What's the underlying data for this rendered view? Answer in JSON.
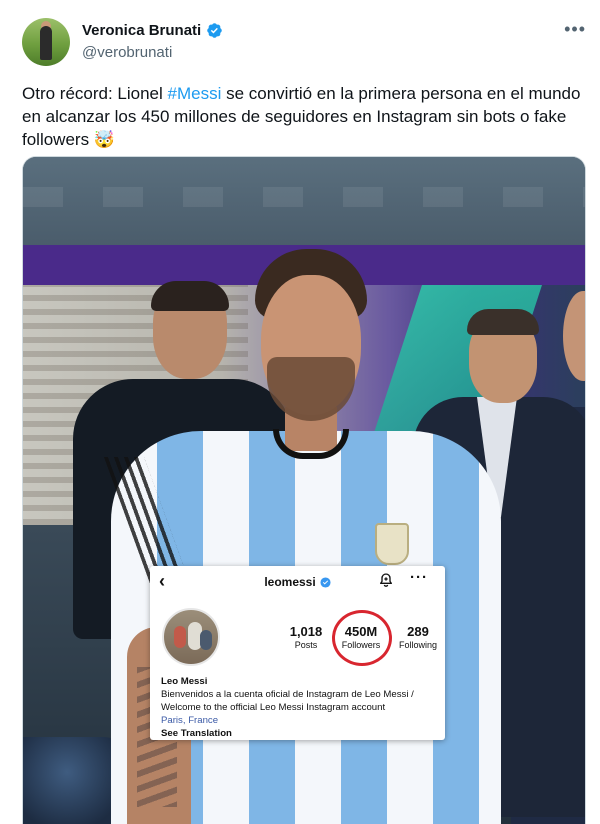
{
  "author": {
    "name": "Veronica Brunati",
    "handle": "@verobrunati",
    "verified": true,
    "verified_color": "#1d9bf0"
  },
  "more_icon": "more-horizontal-icon",
  "tweet": {
    "text_before": "Otro récord: Lionel ",
    "hashtag": "#Messi",
    "text_after": " se convirtió en la primera persona en el mundo en alcanzar los 450 millones de seguidores en Instagram sin bots o fake followers 🤯",
    "hashtag_color": "#1d9bf0"
  },
  "media": {
    "instagram_card": {
      "username": "leomessi",
      "verified": true,
      "stats": {
        "posts_value": "1,018",
        "posts_label": "Posts",
        "followers_value": "450M",
        "followers_label": "Followers",
        "following_value": "289",
        "following_label": "Following"
      },
      "highlight_color": "#d8262f",
      "bio_name": "Leo Messi",
      "bio_line1": "Bienvenidos a la cuenta oficial de Instagram de Leo Messi /",
      "bio_line2": "Welcome to the official Leo Messi Instagram account",
      "location": "Paris, France",
      "see_translation": "See Translation"
    }
  }
}
